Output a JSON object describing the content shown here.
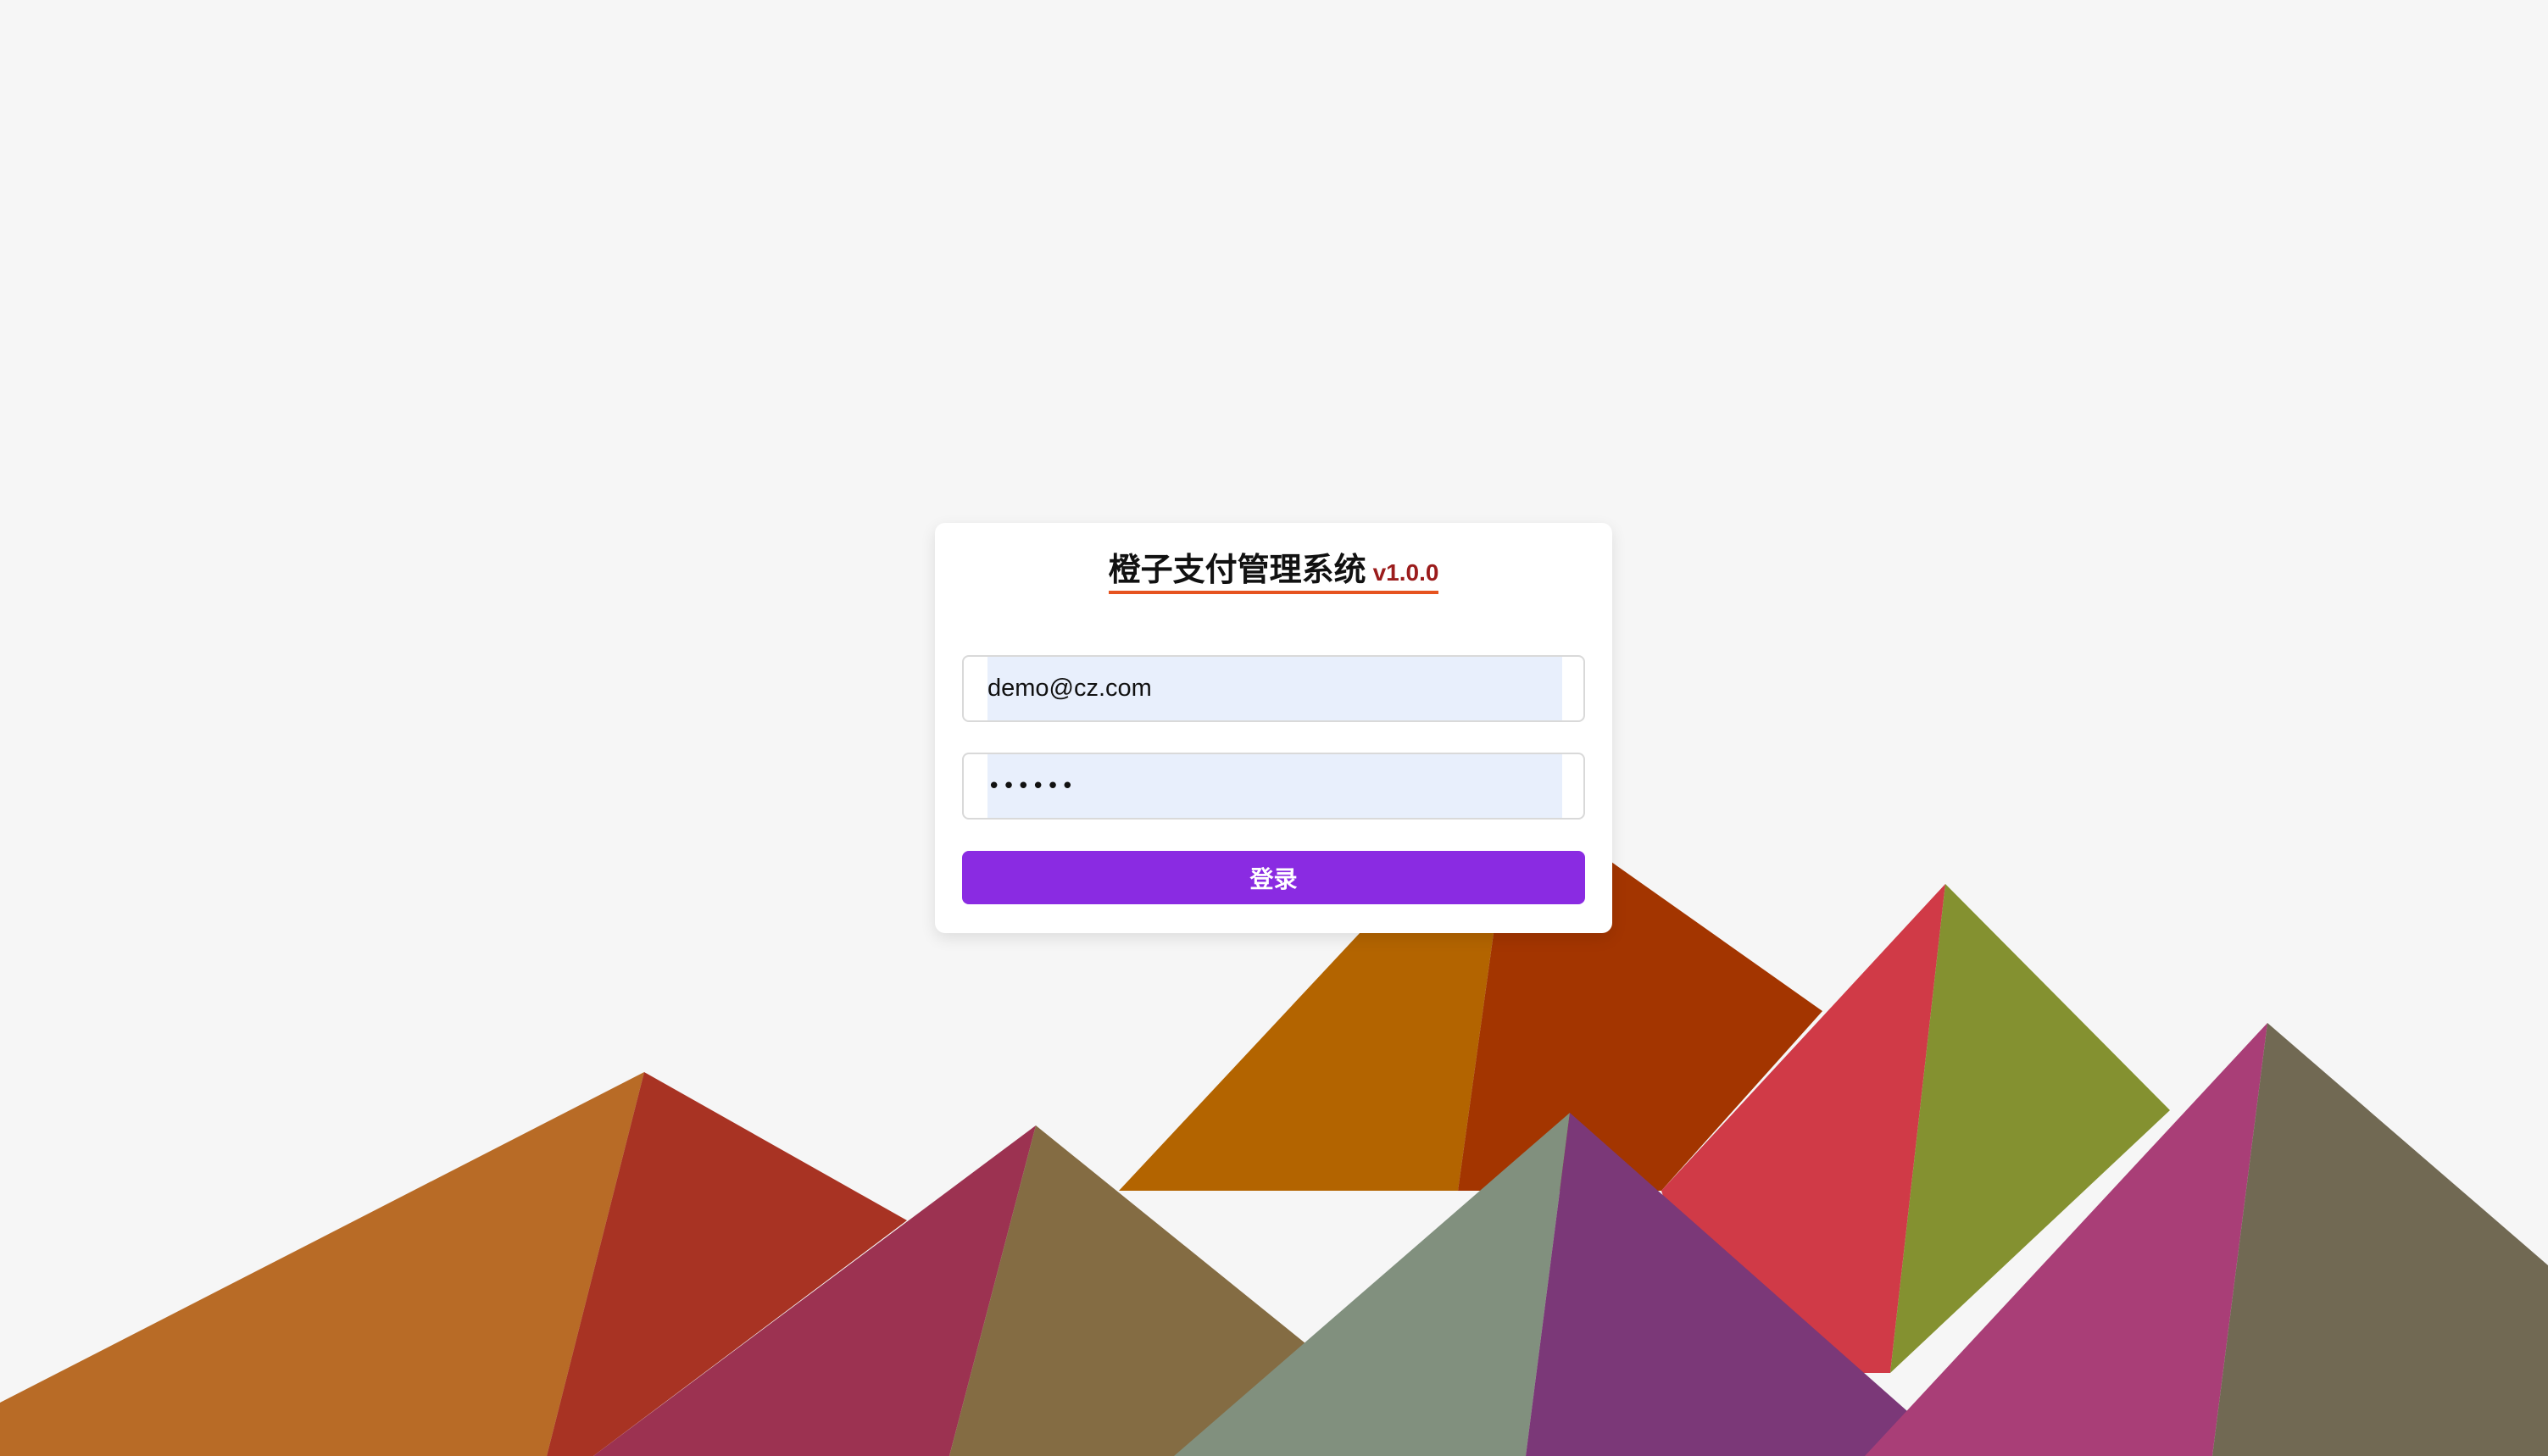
{
  "app": {
    "title": "橙子支付管理系统",
    "version": "v1.0.0"
  },
  "login": {
    "email_value": "demo@cz.com",
    "password_value": "••••••",
    "submit_label": "登录"
  },
  "colors": {
    "background": "#f6f6f6",
    "accent_underline": "#e6531f",
    "version": "#9b1c1c",
    "button": "#8a2be2",
    "input_fill": "#e8effc"
  },
  "background_art": "low-poly mountain range"
}
